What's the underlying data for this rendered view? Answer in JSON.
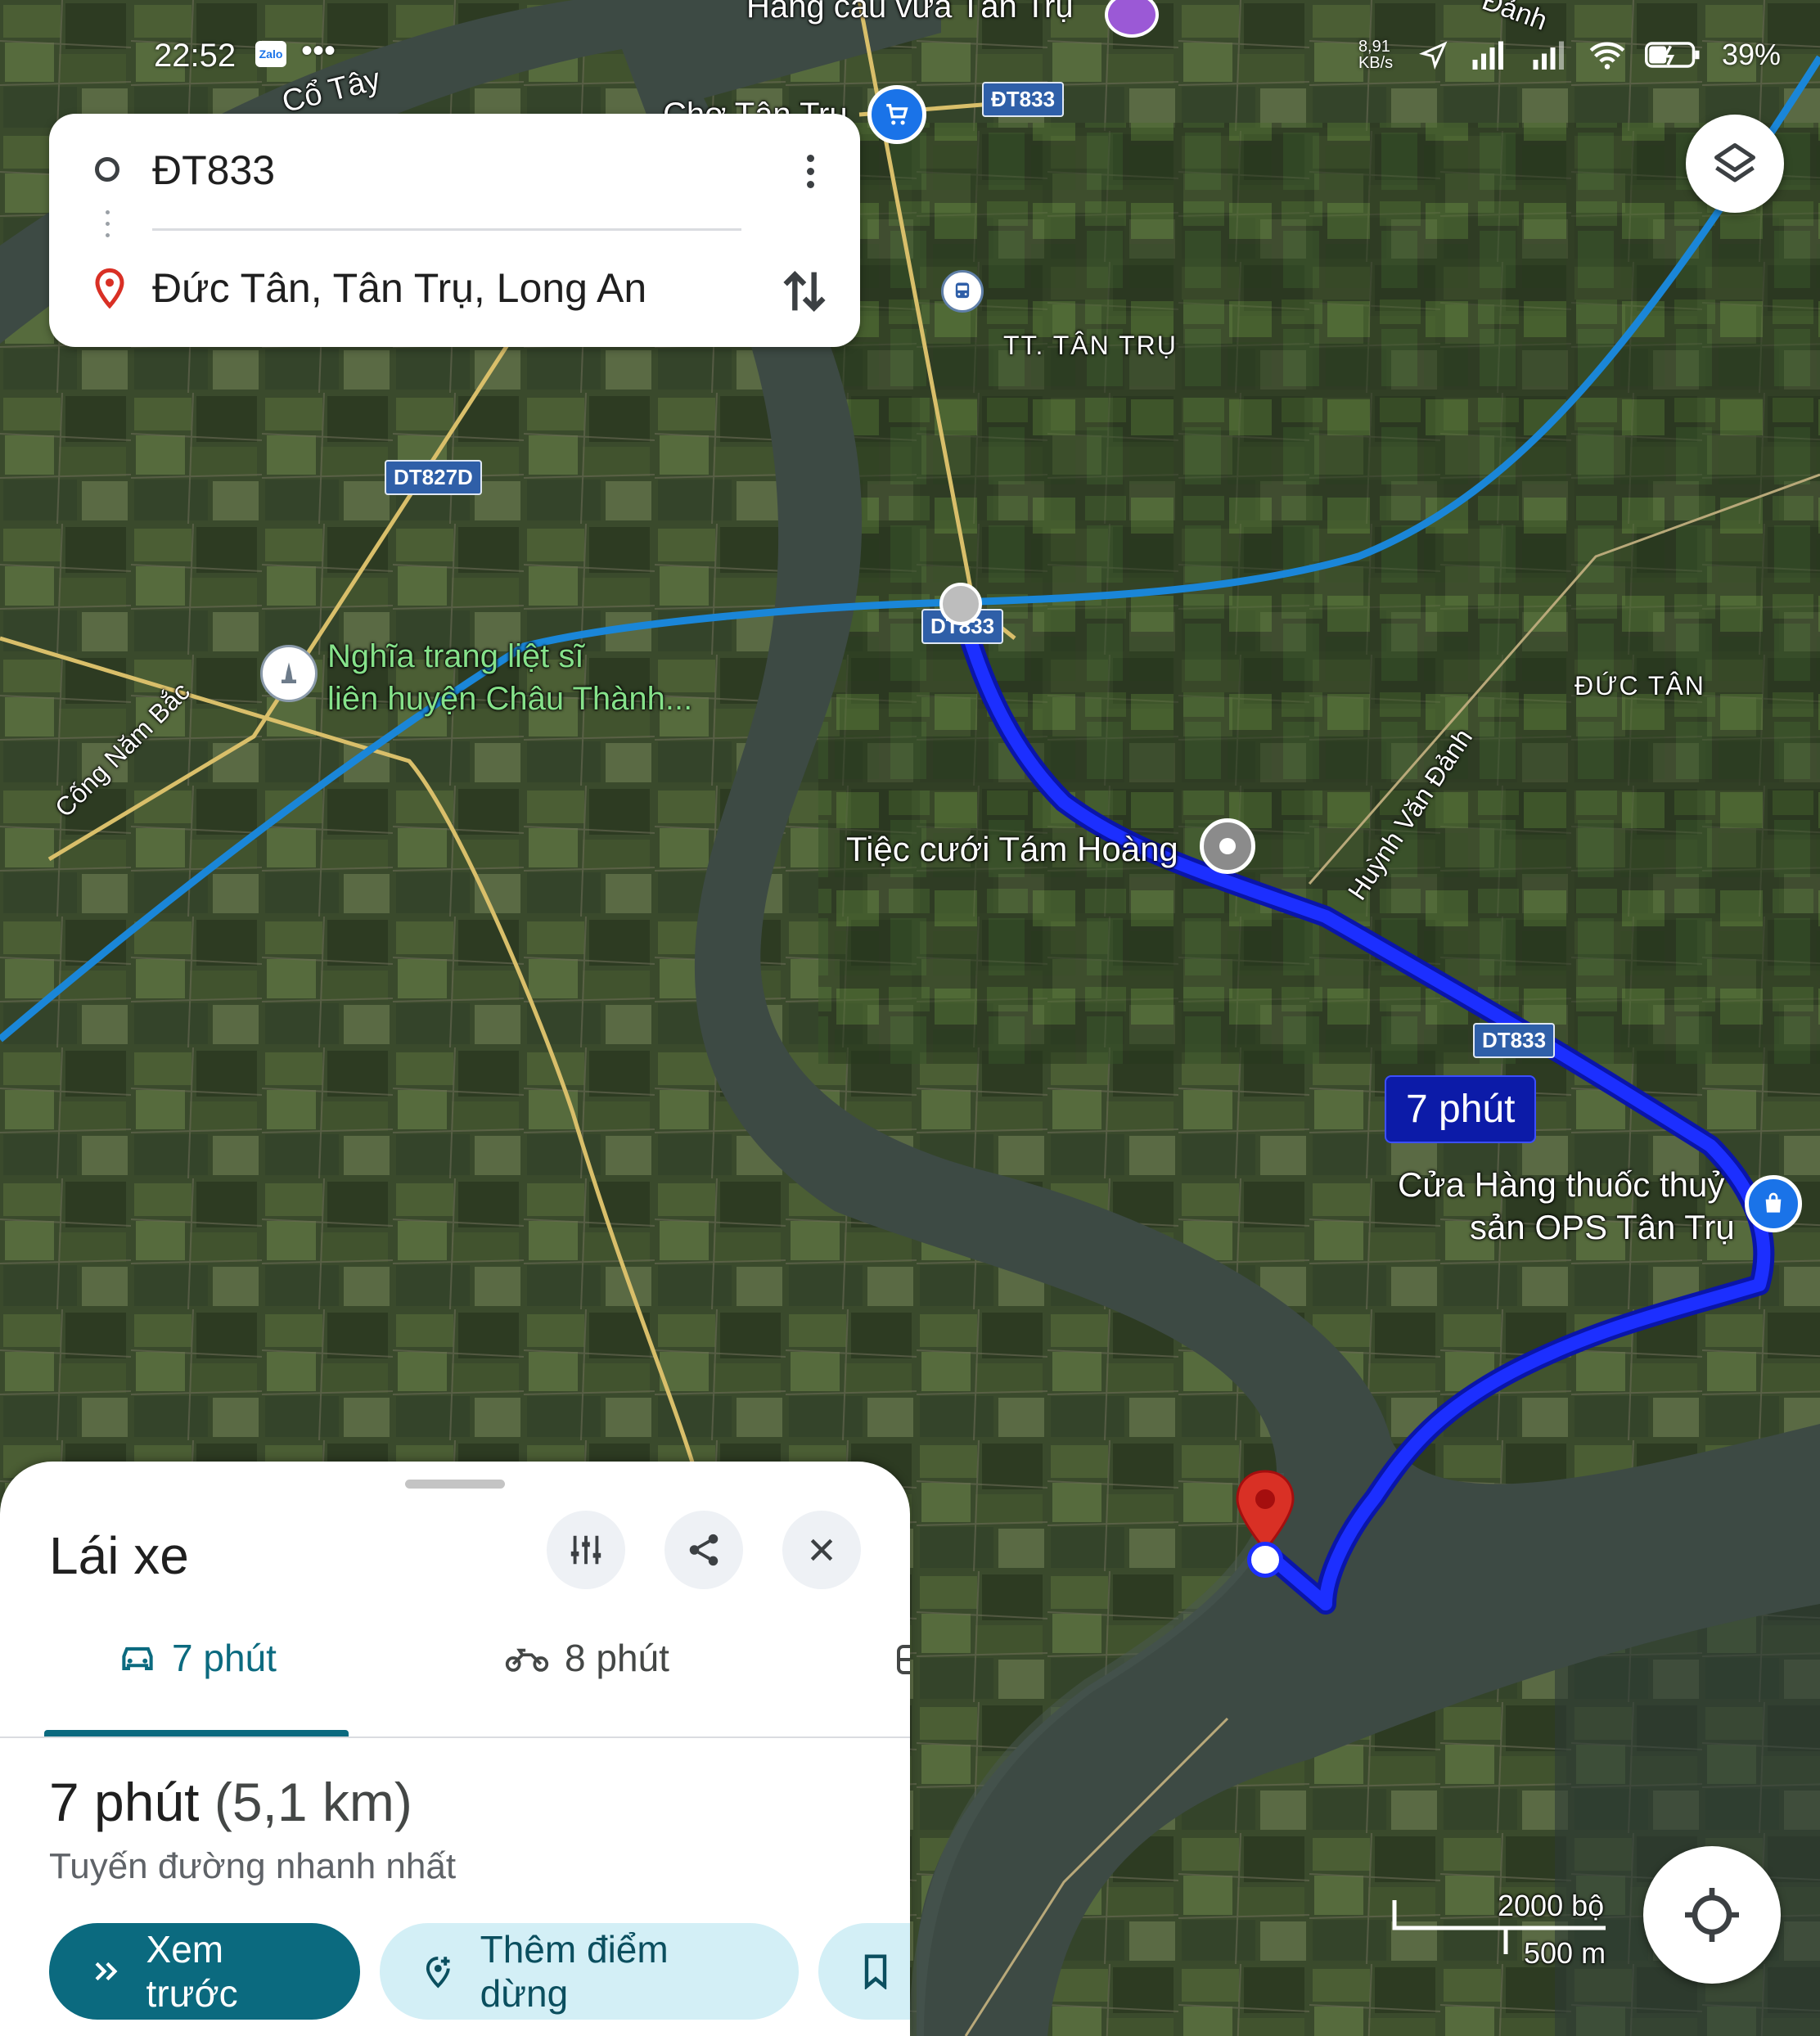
{
  "status_bar": {
    "time": "22:52",
    "network_speed": "8,91 KB/s",
    "battery": "39%"
  },
  "route_card": {
    "origin": "ĐT833",
    "destination": "Đức Tân, Tân Trụ, Long An"
  },
  "map": {
    "labels": {
      "top_store": "Hàng cau vừa Tân Trụ",
      "cho": "Chợ Tân Trụ",
      "river_top": "Cổ Tây",
      "town": "TT. TÂN TRỤ",
      "duc_tan": "ĐỨC TÂN",
      "cemetery_1": "Nghĩa trang liệt sĩ",
      "cemetery_2": "liên huyện Châu Thành...",
      "cong_nam_bac": "Cống Năm Bắc",
      "huynh_van_danh": "Huỳnh Văn Đảnh",
      "danh_top": "Đảnh",
      "wedding": "Tiệc cưới Tám Hoàng",
      "shop_1": "Cửa Hàng thuốc thuỷ",
      "shop_2": "sản OPS Tân Trụ"
    },
    "road_shields": {
      "dt833_top": "ĐT833",
      "dt827d": "DT827D",
      "dt833_mid": "DT833",
      "dt833_right": "DT833"
    },
    "route_time_badge": "7 phút",
    "scale": {
      "imperial": "2000 bộ",
      "metric": "500 m"
    },
    "colors": {
      "route": "#1c2fff",
      "alt_route": "#1a86d8",
      "destination": "#d93025"
    }
  },
  "sheet": {
    "title": "Lái xe",
    "tabs": [
      {
        "label": "7 phút",
        "icon": "car-icon",
        "active": true
      },
      {
        "label": "8 phút",
        "icon": "motorbike-icon",
        "active": false
      }
    ],
    "summary_time": "7 phút",
    "summary_distance": "(5,1 km)",
    "subtitle": "Tuyến đường nhanh nhất",
    "buttons": {
      "preview": "Xem trước",
      "add_stop": "Thêm điểm dừng"
    }
  }
}
